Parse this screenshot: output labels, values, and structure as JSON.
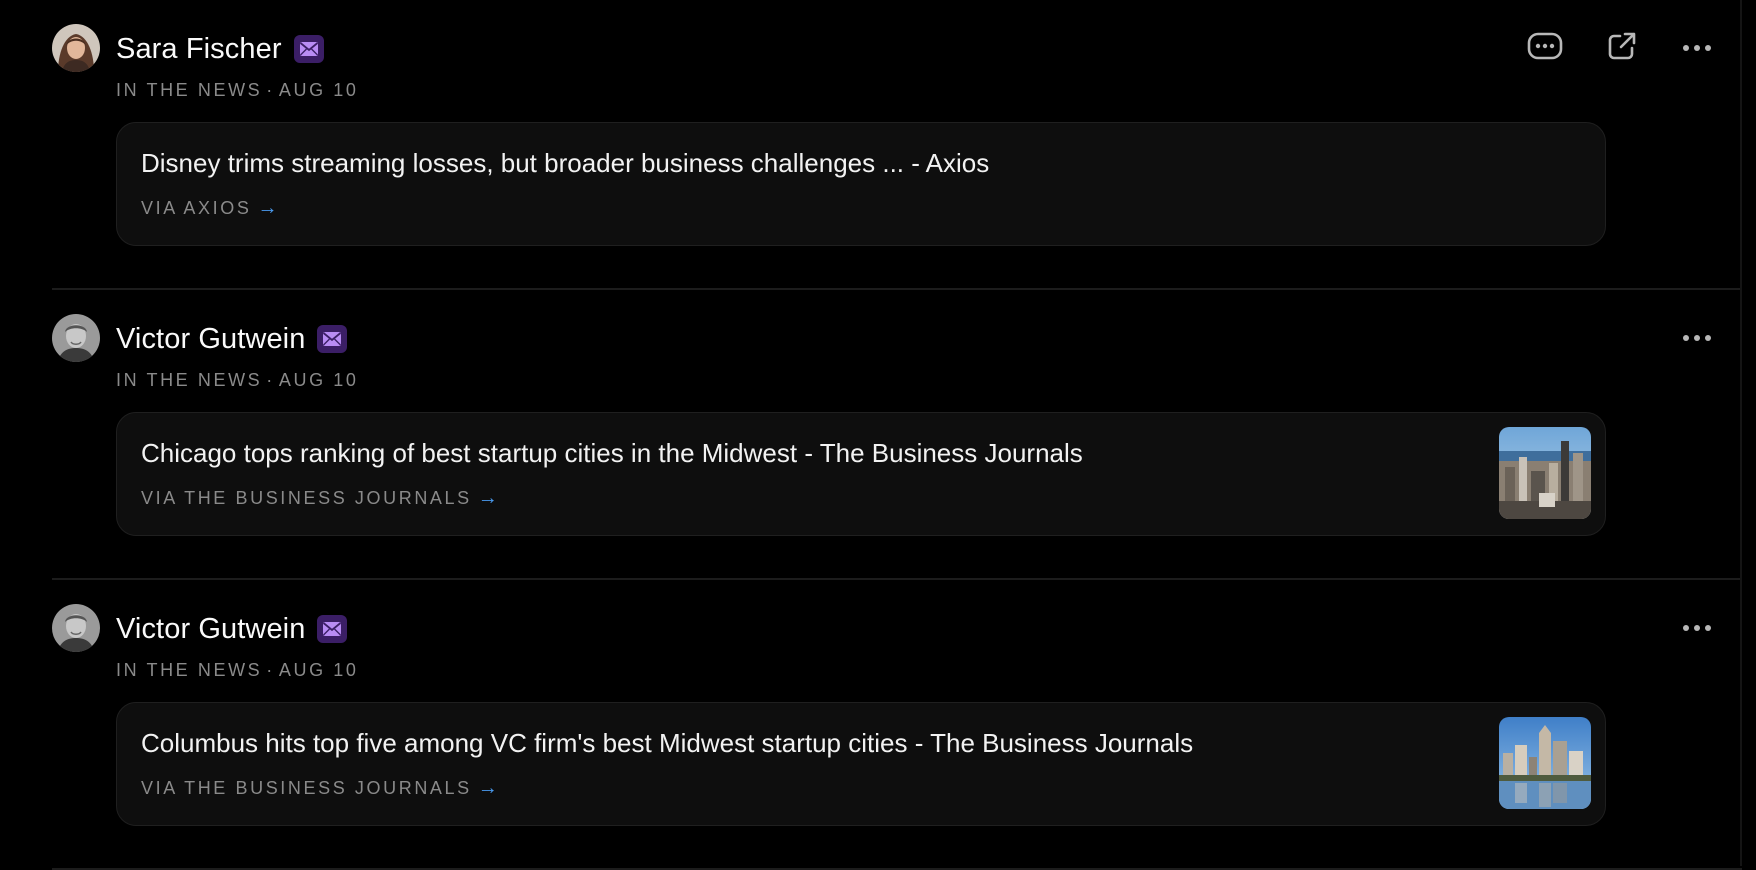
{
  "feed": {
    "items": [
      {
        "author": "Sara Fischer",
        "badge_icon": "mail-icon",
        "category": "IN THE NEWS",
        "date": "AUG 10",
        "headline": "Disney trims streaming losses, but broader business challenges ... - Axios",
        "source": "VIA AXIOS",
        "has_thumbnail": false,
        "actions": [
          "comment-icon",
          "external-link-icon",
          "more-icon"
        ]
      },
      {
        "author": "Victor Gutwein",
        "badge_icon": "mail-icon",
        "category": "IN THE NEWS",
        "date": "AUG 10",
        "headline": "Chicago tops ranking of best startup cities in the Midwest - The Business Journals",
        "source": "VIA THE BUSINESS JOURNALS",
        "has_thumbnail": true,
        "thumbnail": "chicago-skyline-thumbnail",
        "actions": [
          "more-icon"
        ]
      },
      {
        "author": "Victor Gutwein",
        "badge_icon": "mail-icon",
        "category": "IN THE NEWS",
        "date": "AUG 10",
        "headline": "Columbus hits top five among VC firm's best Midwest startup cities - The Business Journals",
        "source": "VIA THE BUSINESS JOURNALS",
        "has_thumbnail": true,
        "thumbnail": "columbus-skyline-thumbnail",
        "actions": [
          "more-icon"
        ]
      }
    ]
  },
  "separator": "·",
  "arrow_glyph": "→",
  "colors": {
    "background": "#000000",
    "card": "#0e0e0e",
    "badge": "#3b1e66",
    "badge_icon": "#b98cf5",
    "link_arrow": "#4a9bf0",
    "muted_text": "#8a8a8a"
  }
}
